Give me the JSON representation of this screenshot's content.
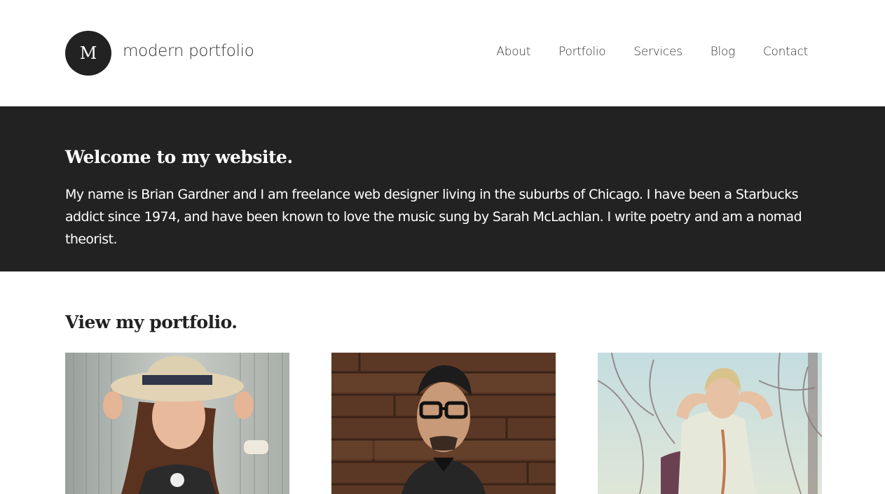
{
  "site": {
    "logo_letter": "M",
    "logo_text": "modern portfolio"
  },
  "nav": {
    "items": [
      "About",
      "Portfolio",
      "Services",
      "Blog",
      "Contact"
    ]
  },
  "hero": {
    "title": "Welcome to my website.",
    "text": "My name is Brian Gardner and I am freelance web designer living in the suburbs of Chicago. I have been a Starbucks addict since 1974, and have been known to love the music sung by Sarah McLachlan. I write poetry and am a nomad theorist."
  },
  "portfolio": {
    "title": "View my portfolio.",
    "items": [
      {
        "image": "portrait-woman-hat-photo"
      },
      {
        "image": "portrait-man-glasses-photo"
      },
      {
        "image": "portrait-woman-branches-photo"
      }
    ]
  },
  "colors": {
    "hero_bg": "#222222",
    "text": "#333333",
    "background": "#ffffff"
  }
}
